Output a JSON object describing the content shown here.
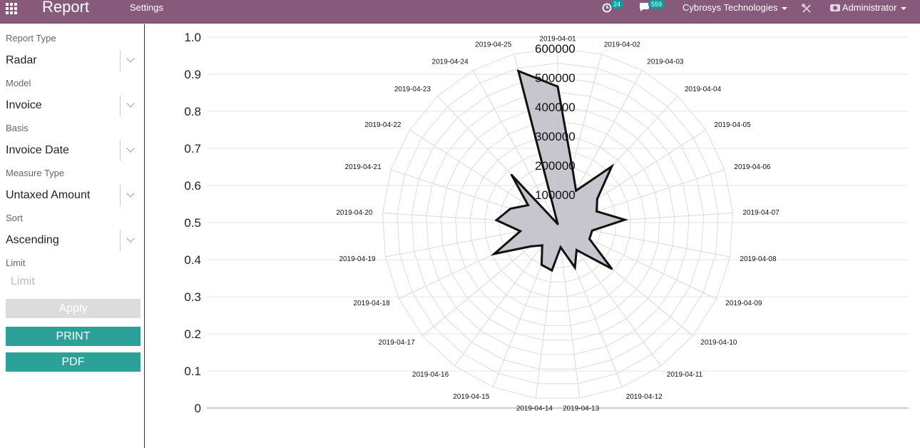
{
  "navbar": {
    "brand": "Report",
    "menu": [
      "Settings"
    ],
    "activity_count": "24",
    "messages_count": "559",
    "company": "Cybrosys Technologies",
    "user": "Administrator",
    "icons": [
      "apps-grid-icon",
      "clock-icon",
      "chat-icon",
      "debug-tools-icon",
      "user-avatar-icon"
    ],
    "color": "#875a7b"
  },
  "sidebar": {
    "fields": [
      {
        "label": "Report Type",
        "value": "Radar"
      },
      {
        "label": "Model",
        "value": "Invoice"
      },
      {
        "label": "Basis",
        "value": "Invoice Date"
      },
      {
        "label": "Measure Type",
        "value": "Untaxed Amount"
      },
      {
        "label": "Sort",
        "value": "Ascending"
      }
    ],
    "limit_label": "Limit",
    "limit_placeholder": "Limit",
    "limit_value": "",
    "apply_label": "Apply",
    "print_label": "PRINT",
    "pdf_label": "PDF",
    "button_color": "#2ca19a"
  },
  "chart_data": {
    "type": "radar",
    "title": "",
    "categories": [
      "2019-04-01",
      "2019-04-02",
      "2019-04-03",
      "2019-04-04",
      "2019-04-05",
      "2019-04-06",
      "2019-04-07",
      "2019-04-08",
      "2019-04-09",
      "2019-04-10",
      "2019-04-11",
      "2019-04-12",
      "2019-04-13",
      "2019-04-14",
      "2019-04-15",
      "2019-04-16",
      "2019-04-17",
      "2019-04-18",
      "2019-04-19",
      "2019-04-20",
      "2019-04-21",
      "2019-04-22",
      "2019-04-23",
      "2019-04-24",
      "2019-04-25"
    ],
    "values": [
      470000,
      200000,
      130000,
      270000,
      160000,
      140000,
      230000,
      120000,
      120000,
      240000,
      110000,
      160000,
      80000,
      160000,
      150000,
      90000,
      120000,
      240000,
      130000,
      210000,
      170000,
      120000,
      230000,
      0,
      540000
    ],
    "radial_ticks": [
      100000,
      200000,
      300000,
      400000,
      500000,
      600000
    ],
    "radial_max": 600000,
    "y_axis_ticks": [
      "0",
      "0.1",
      "0.2",
      "0.3",
      "0.4",
      "0.5",
      "0.6",
      "0.7",
      "0.8",
      "0.9",
      "1.0"
    ],
    "ylim": [
      0,
      1
    ],
    "fill_color": "#c4c3cb",
    "line_color": "#111111",
    "grid": true
  }
}
